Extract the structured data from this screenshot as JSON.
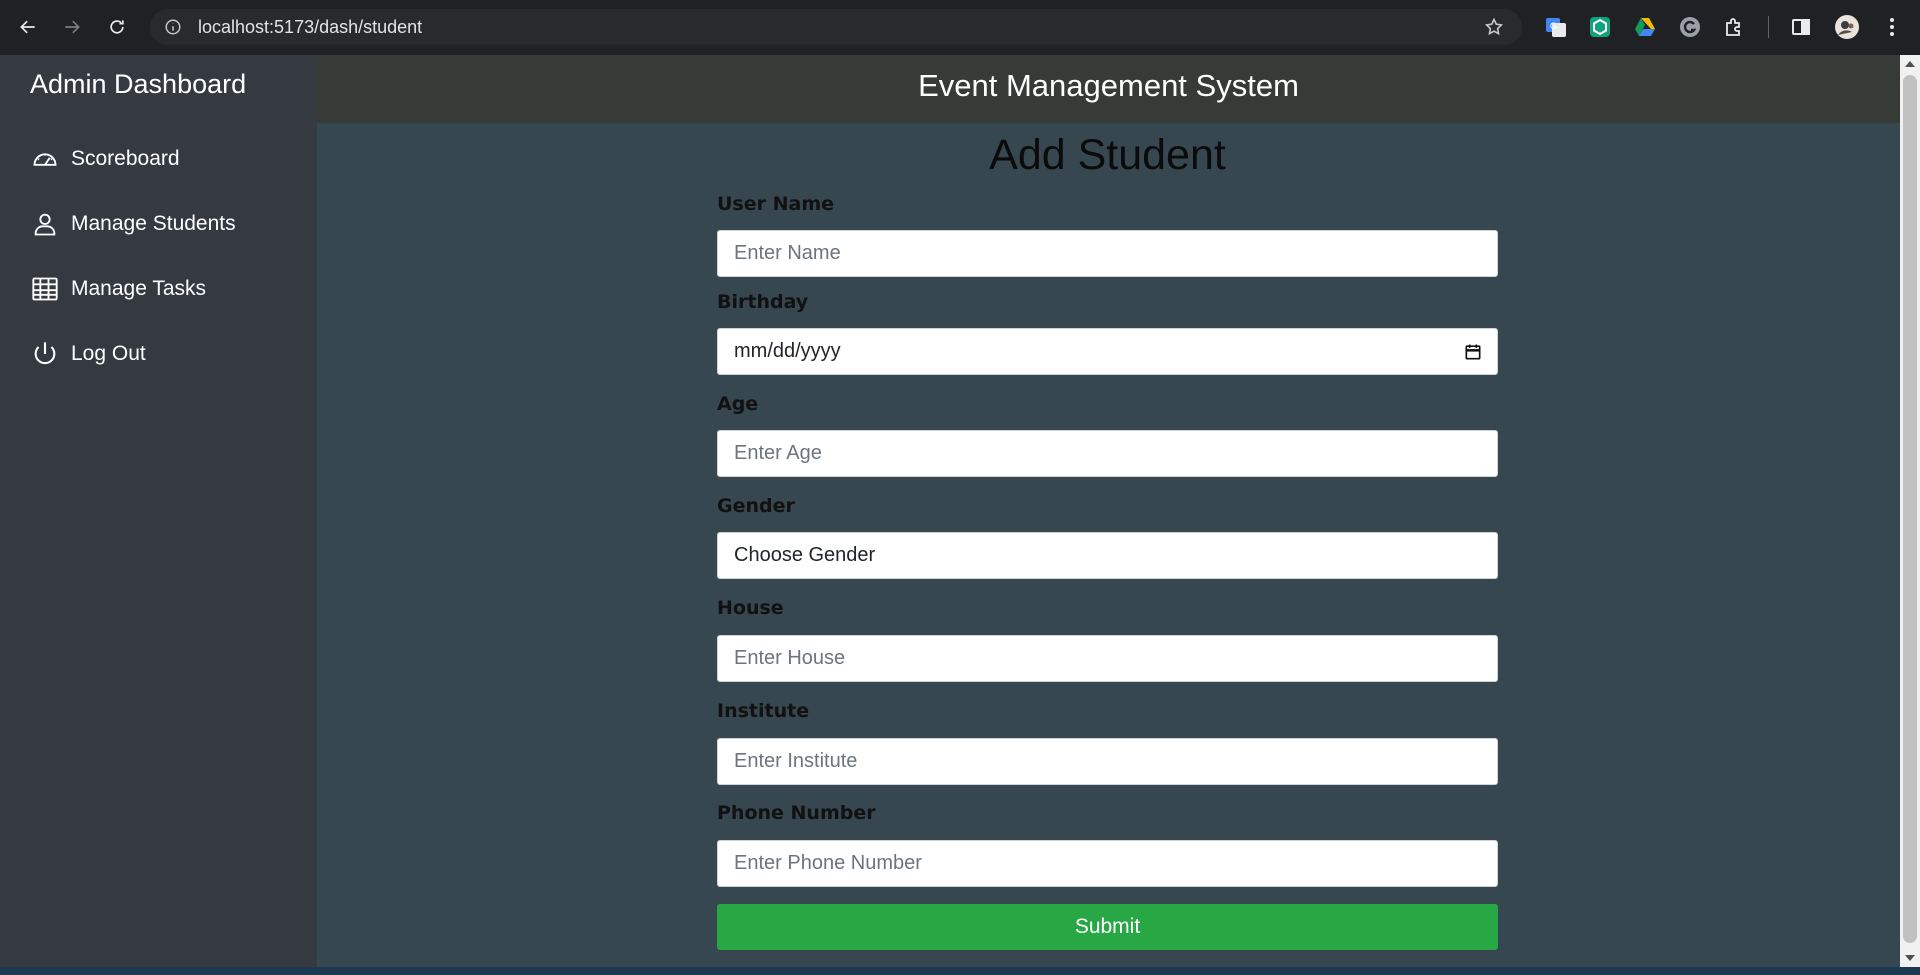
{
  "browser": {
    "url": "localhost:5173/dash/student",
    "icons": [
      "back-icon",
      "forward-icon",
      "reload-icon",
      "site-info-icon",
      "bookmark-star-icon",
      "google-translate-icon",
      "extension-hex-icon",
      "google-drive-icon",
      "grammarly-icon",
      "extensions-puzzle-icon",
      "side-panel-icon",
      "profile-avatar",
      "menu-dots-icon"
    ]
  },
  "sidebar": {
    "title": "Admin Dashboard",
    "items": [
      {
        "label": "Scoreboard",
        "icon": "speedometer-icon"
      },
      {
        "label": "Manage Students",
        "icon": "person-icon"
      },
      {
        "label": "Manage Tasks",
        "icon": "table-grid-icon"
      },
      {
        "label": "Log Out",
        "icon": "power-icon"
      }
    ]
  },
  "header": {
    "title": "Event Management System"
  },
  "form": {
    "title": "Add Student",
    "fields": [
      {
        "label": "User Name",
        "placeholder": "Enter Name"
      },
      {
        "label": "Birthday",
        "value": "mm/dd/yyyy"
      },
      {
        "label": "Age",
        "placeholder": "Enter Age"
      },
      {
        "label": "Gender",
        "value": "Choose Gender"
      },
      {
        "label": "House",
        "placeholder": "Enter House"
      },
      {
        "label": "Institute",
        "placeholder": "Enter Institute"
      },
      {
        "label": "Phone Number",
        "placeholder": "Enter Phone Number"
      }
    ],
    "submit_label": "Submit"
  },
  "colors": {
    "sidebar_bg": "#343a40",
    "content_bg": "#37474f",
    "header_bg": "#373b38",
    "submit_bg": "#28a745"
  }
}
